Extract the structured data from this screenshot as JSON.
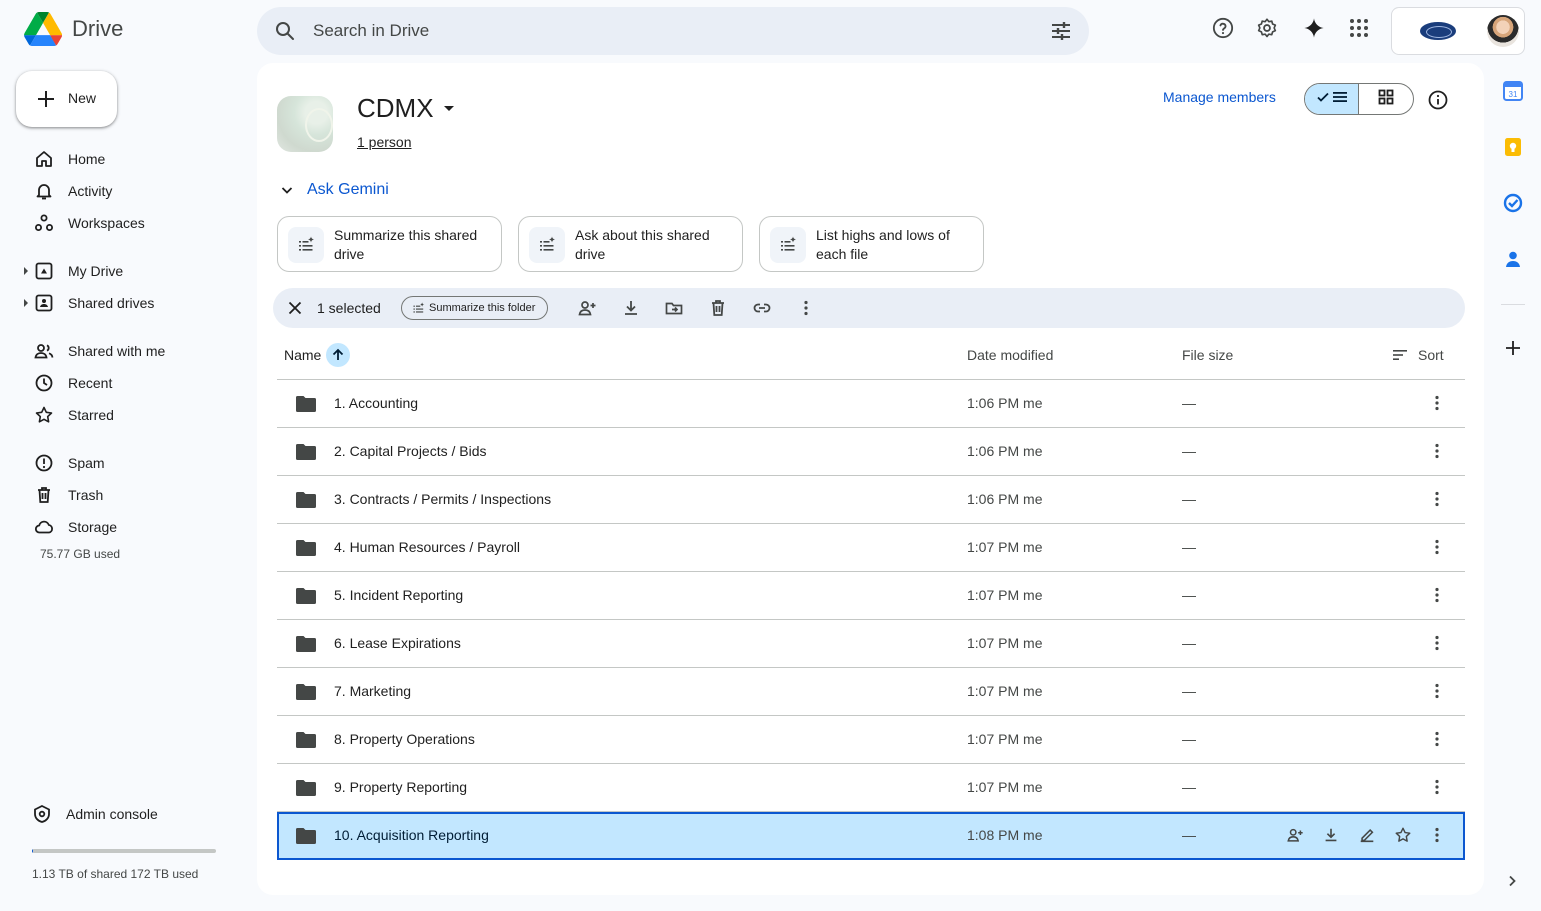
{
  "app": {
    "name": "Drive"
  },
  "search": {
    "placeholder": "Search in Drive"
  },
  "topbar": {
    "icons": [
      "help-icon",
      "settings-icon",
      "gemini-icon",
      "apps-grid-icon"
    ]
  },
  "sidebar": {
    "new_label": "New",
    "items": [
      {
        "label": "Home",
        "icon": "home-icon"
      },
      {
        "label": "Activity",
        "icon": "bell-icon"
      },
      {
        "label": "Workspaces",
        "icon": "workspaces-icon"
      },
      {
        "label": "My Drive",
        "icon": "my-drive-icon"
      },
      {
        "label": "Shared drives",
        "icon": "shared-drives-icon"
      },
      {
        "label": "Shared with me",
        "icon": "people-icon"
      },
      {
        "label": "Recent",
        "icon": "clock-icon"
      },
      {
        "label": "Starred",
        "icon": "star-icon"
      },
      {
        "label": "Spam",
        "icon": "spam-icon"
      },
      {
        "label": "Trash",
        "icon": "trash-icon"
      },
      {
        "label": "Storage",
        "icon": "cloud-icon"
      }
    ],
    "storage_used": "75.77 GB used",
    "admin_label": "Admin console",
    "quota_text": "1.13 TB of shared 172 TB used",
    "quota_fraction": 0.0066
  },
  "drive": {
    "title": "CDMX",
    "people": "1 person",
    "manage_members": "Manage members"
  },
  "gemini": {
    "title": "Ask Gemini",
    "chips": [
      "Summarize this shared drive",
      "Ask about this shared drive",
      "List highs and lows of each file"
    ]
  },
  "selection": {
    "count": "1 selected",
    "summarize_folder": "Summarize this folder"
  },
  "table": {
    "headers": {
      "name": "Name",
      "date": "Date modified",
      "size": "File size",
      "sort": "Sort"
    },
    "rows": [
      {
        "name": "1. Accounting",
        "date": "1:06 PM me",
        "size": "—"
      },
      {
        "name": "2. Capital Projects / Bids",
        "date": "1:06 PM me",
        "size": "—"
      },
      {
        "name": "3. Contracts / Permits / Inspections",
        "date": "1:06 PM me",
        "size": "—"
      },
      {
        "name": "4. Human Resources / Payroll",
        "date": "1:07 PM me",
        "size": "—"
      },
      {
        "name": "5. Incident Reporting",
        "date": "1:07 PM me",
        "size": "—"
      },
      {
        "name": "6. Lease Expirations",
        "date": "1:07 PM me",
        "size": "—"
      },
      {
        "name": "7. Marketing",
        "date": "1:07 PM me",
        "size": "—"
      },
      {
        "name": "8. Property Operations",
        "date": "1:07 PM me",
        "size": "—"
      },
      {
        "name": "9. Property Reporting",
        "date": "1:07 PM me",
        "size": "—"
      },
      {
        "name": "10. Acquisition Reporting",
        "date": "1:08 PM me",
        "size": "—",
        "selected": true
      }
    ]
  },
  "colors": {
    "accent": "#0b57d0",
    "selected_bg": "#c2e7ff",
    "panel_bg": "#f8fafd"
  },
  "side_apps": [
    "calendar-icon",
    "keep-icon",
    "tasks-icon",
    "contacts-icon"
  ]
}
